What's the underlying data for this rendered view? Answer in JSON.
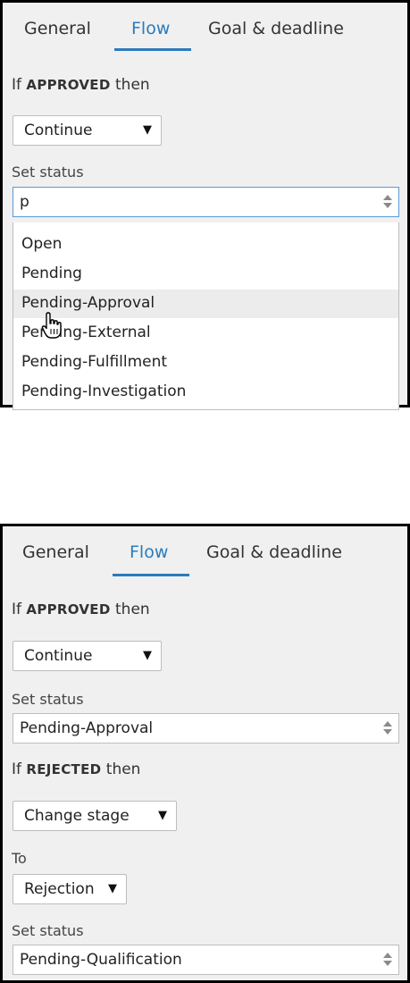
{
  "tabs": [
    "General",
    "Flow",
    "Goal & deadline"
  ],
  "top": {
    "approved_prefix": "If",
    "approved_keyword": "APPROVED",
    "approved_suffix": "then",
    "approved_action": "Continue",
    "set_status_label": "Set status",
    "status_input_value": "p",
    "dropdown_options": [
      "Open",
      "Pending",
      "Pending-Approval",
      "Pending-External",
      "Pending-Fulfillment",
      "Pending-Investigation"
    ],
    "highlighted_option": "Pending-Approval"
  },
  "bottom": {
    "approved_prefix": "If",
    "approved_keyword": "APPROVED",
    "approved_suffix": "then",
    "approved_action": "Continue",
    "set_status_label": "Set status",
    "approved_status": "Pending-Approval",
    "rejected_prefix": "If",
    "rejected_keyword": "REJECTED",
    "rejected_suffix": "then",
    "rejected_action": "Change stage",
    "to_label": "To",
    "to_stage": "Rejection",
    "set_status_label_2": "Set status",
    "rejected_status": "Pending-Qualification"
  },
  "colors": {
    "accent": "#2b7bbd",
    "panel_bg": "#f0f0f0",
    "highlight": "#ececec"
  },
  "icons": {
    "dropdown_arrow": "▼",
    "cursor": "hand-pointer-icon",
    "spinner": "up-down-arrows-icon"
  }
}
